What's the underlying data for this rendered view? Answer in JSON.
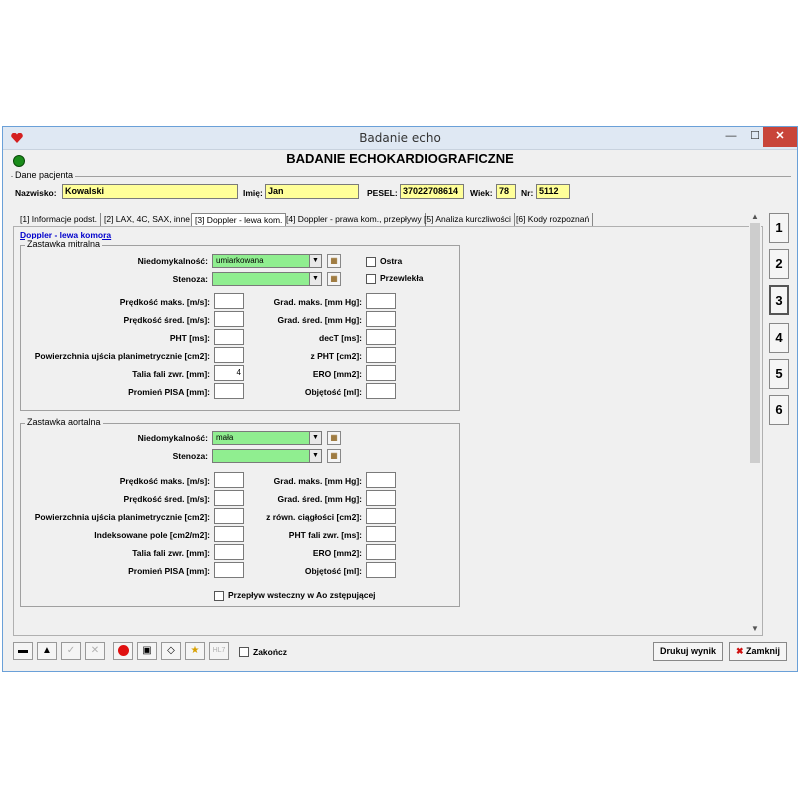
{
  "window": {
    "title": "Badanie echo",
    "min": "—",
    "max": "☐",
    "close": "✕"
  },
  "header": {
    "title": "BADANIE ECHOKARDIOGRAFICZNE"
  },
  "patient": {
    "group_title": "Dane pacjenta",
    "surname_label": "Nazwisko:",
    "surname": "Kowalski",
    "name_label": "Imię:",
    "name": "Jan",
    "pesel_label": "PESEL:",
    "pesel": "37022708614",
    "age_label": "Wiek:",
    "age": "78",
    "nr_label": "Nr:",
    "nr": "5112"
  },
  "tabs": [
    {
      "label": "[1] Informacje podst."
    },
    {
      "label": "[2] LAX, 4C, SAX, inne"
    },
    {
      "label": "[3] Doppler - lewa kom."
    },
    {
      "label": "[4] Doppler - prawa kom., przepływy"
    },
    {
      "label": "[5] Analiza kurczliwości"
    },
    {
      "label": "[6] Kody rozpoznań"
    }
  ],
  "sublink": "Doppler - lewa komora",
  "mitral": {
    "title": "Zastawka mitralna",
    "niedomyk_label": "Niedomykalność:",
    "niedomyk_value": "umiarkowana",
    "stenoza_label": "Stenoza:",
    "stenoza_value": "",
    "ostra": "Ostra",
    "przewlekla": "Przewlekła",
    "left": [
      {
        "label": "Prędkość maks. [m/s]:",
        "value": ""
      },
      {
        "label": "Prędkość śred. [m/s]:",
        "value": ""
      },
      {
        "label": "PHT [ms]:",
        "value": ""
      },
      {
        "label": "Powierzchnia ujścia planimetrycznie [cm2]:",
        "value": ""
      },
      {
        "label": "Talia fali zwr. [mm]:",
        "value": "4"
      },
      {
        "label": "Promień PISA [mm]:",
        "value": ""
      }
    ],
    "right": [
      {
        "label": "Grad. maks. [mm Hg]:",
        "value": ""
      },
      {
        "label": "Grad. śred. [mm Hg]:",
        "value": ""
      },
      {
        "label": "decT [ms]:",
        "value": ""
      },
      {
        "label": "z PHT [cm2]:",
        "value": ""
      },
      {
        "label": "ERO [mm2]:",
        "value": ""
      },
      {
        "label": "Objętość [ml]:",
        "value": ""
      }
    ]
  },
  "aortic": {
    "title": "Zastawka aortalna",
    "niedomyk_label": "Niedomykalność:",
    "niedomyk_value": "mała",
    "stenoza_label": "Stenoza:",
    "stenoza_value": "",
    "left": [
      {
        "label": "Prędkość maks. [m/s]:",
        "value": ""
      },
      {
        "label": "Prędkość śred. [m/s]:",
        "value": ""
      },
      {
        "label": "Powierzchnia ujścia planimetrycznie [cm2]:",
        "value": ""
      },
      {
        "label": "Indeksowane pole [cm2/m2]:",
        "value": ""
      },
      {
        "label": "Talia fali zwr. [mm]:",
        "value": ""
      },
      {
        "label": "Promień PISA [mm]:",
        "value": ""
      }
    ],
    "right": [
      {
        "label": "Grad. maks. [mm Hg]:",
        "value": ""
      },
      {
        "label": "Grad. śred. [mm Hg]:",
        "value": ""
      },
      {
        "label": "z równ. ciągłości [cm2]:",
        "value": ""
      },
      {
        "label": "PHT fali zwr. [ms]:",
        "value": ""
      },
      {
        "label": "ERO [mm2]:",
        "value": ""
      },
      {
        "label": "Objętość [ml]:",
        "value": ""
      }
    ],
    "backflow": "Przepływ wsteczny w Ao zstępującej"
  },
  "side_buttons": [
    "1",
    "2",
    "3",
    "4",
    "5",
    "6"
  ],
  "bottom": {
    "hl7": "HL7",
    "finish": "Zakończ",
    "print": "Drukuj wynik",
    "close": "Zamknij"
  }
}
